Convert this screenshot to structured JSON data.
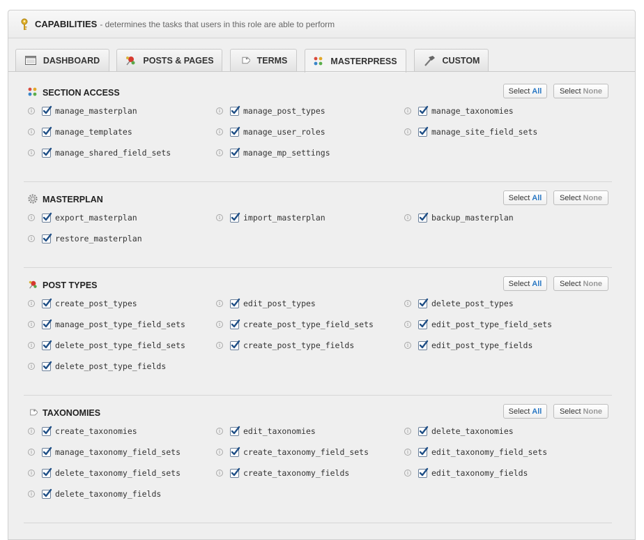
{
  "header": {
    "title": "CAPABILITIES",
    "description": "- determines the tasks that users in this role are able to perform"
  },
  "tabs": [
    {
      "label": "DASHBOARD",
      "icon": "dashboard-icon",
      "active": false
    },
    {
      "label": "POSTS & PAGES",
      "icon": "pushpin-icon",
      "active": false
    },
    {
      "label": "TERMS",
      "icon": "tag-icon",
      "active": false
    },
    {
      "label": "MASTERPRESS",
      "icon": "masterpress-dots-icon",
      "active": true
    },
    {
      "label": "CUSTOM",
      "icon": "hammer-icon",
      "active": false
    }
  ],
  "buttons": {
    "select_prefix": "Select",
    "all": "All",
    "none": "None"
  },
  "sections": [
    {
      "title": "SECTION ACCESS",
      "icon": "masterpress-dots-icon",
      "capabilities": [
        "manage_masterplan",
        "manage_post_types",
        "manage_taxonomies",
        "manage_templates",
        "manage_user_roles",
        "manage_site_field_sets",
        "manage_shared_field_sets",
        "manage_mp_settings"
      ]
    },
    {
      "title": "MASTERPLAN",
      "icon": "gear-icon",
      "capabilities": [
        "export_masterplan",
        "import_masterplan",
        "backup_masterplan",
        "restore_masterplan"
      ]
    },
    {
      "title": "POST TYPES",
      "icon": "pushpin-icon",
      "capabilities": [
        "create_post_types",
        "edit_post_types",
        "delete_post_types",
        "manage_post_type_field_sets",
        "create_post_type_field_sets",
        "edit_post_type_field_sets",
        "delete_post_type_field_sets",
        "create_post_type_fields",
        "edit_post_type_fields",
        "delete_post_type_fields"
      ]
    },
    {
      "title": "TAXONOMIES",
      "icon": "tag-icon",
      "capabilities": [
        "create_taxonomies",
        "edit_taxonomies",
        "delete_taxonomies",
        "manage_taxonomy_field_sets",
        "create_taxonomy_field_sets",
        "edit_taxonomy_field_sets",
        "delete_taxonomy_field_sets",
        "create_taxonomy_fields",
        "edit_taxonomy_fields",
        "delete_taxonomy_fields"
      ]
    }
  ],
  "colors": {
    "accent_blue": "#2a78c4",
    "checkbox_check": "#1f4f86"
  }
}
